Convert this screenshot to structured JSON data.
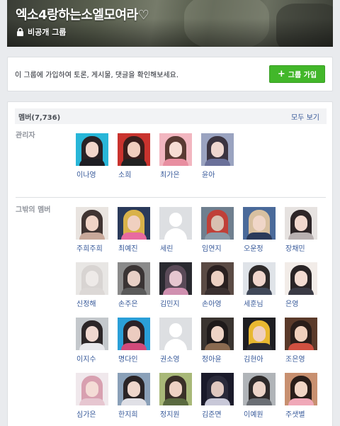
{
  "group": {
    "title": "엑소4랑하는소엘모여라♡",
    "privacy": "비공개 그룹",
    "join_prompt": "이 그룹에 가입하여 토론, 게시물, 댓글을 확인해보세요.",
    "join_button": "그룹 가입"
  },
  "members": {
    "header": "멤버(7,736)",
    "see_all": "모두 보기",
    "admins_label": "관리자",
    "others_label": "그밖의 멤버",
    "admins": [
      {
        "name": "이나영",
        "bg": "#28b6d8",
        "hair": "#2a2226",
        "skin": "#f2d6cc",
        "body": "#1e1e24"
      },
      {
        "name": "소희",
        "bg": "#c9332e",
        "hair": "#3a1e1c",
        "skin": "#f0cdbd",
        "body": "#222222"
      },
      {
        "name": "최가은",
        "bg": "#f2b6c0",
        "hair": "#5a3a33",
        "skin": "#f6ddd4",
        "body": "#e88ea0"
      },
      {
        "name": "윤아",
        "bg": "#9aa3c0",
        "hair": "#3b3440",
        "skin": "#efd7cf",
        "body": "#6a7099"
      }
    ],
    "others": [
      {
        "name": "주희주희",
        "bg": "#e9e4e0",
        "hair": "#403432",
        "skin": "#f0d3c6",
        "body": "#c8a89a"
      },
      {
        "name": "최예진",
        "bg": "#2a3a5a",
        "hair": "#d9b24a",
        "skin": "#f0d0c0",
        "body": "#e86aa0"
      },
      {
        "name": "세린",
        "default": true
      },
      {
        "name": "임연지",
        "bg": "#6f7f8f",
        "hair": "#c04038",
        "skin": "#d8c0b0",
        "body": "#8a9aa8"
      },
      {
        "name": "오운정",
        "bg": "#4a6a9a",
        "hair": "#d8c0a0",
        "skin": "#f0d6c8",
        "body": "#2a3a5a"
      },
      {
        "name": "장채민",
        "bg": "#e6e2e0",
        "hair": "#2e2628",
        "skin": "#f2d8ce",
        "body": "#b8b0b0"
      },
      {
        "name": "신정해",
        "bg": "#e8e6e4",
        "hair": "#d8d4d2",
        "skin": "#eeeae8",
        "body": "#dcd8d6"
      },
      {
        "name": "손주은",
        "bg": "#8a8a8a",
        "hair": "#3a3434",
        "skin": "#e8d0c6",
        "body": "#5a5a5a"
      },
      {
        "name": "김민지",
        "bg": "#2a2a30",
        "hair": "#5a4a58",
        "skin": "#e6c6d0",
        "body": "#d090b0"
      },
      {
        "name": "손아영",
        "bg": "#5a4a44",
        "hair": "#2a2020",
        "skin": "#ecd0c2",
        "body": "#3a3030"
      },
      {
        "name": "세훈님",
        "bg": "#dfe3e8",
        "hair": "#2e2a2a",
        "skin": "#f0d6cc",
        "body": "#404858"
      },
      {
        "name": "은영",
        "bg": "#f2ece8",
        "hair": "#2a2426",
        "skin": "#f4dcd2",
        "body": "#3a3a44"
      },
      {
        "name": "이지수",
        "bg": "#c4c8cc",
        "hair": "#2c2628",
        "skin": "#f0d8d0",
        "body": "#e8e8ec"
      },
      {
        "name": "명다인",
        "bg": "#2a9fd8",
        "hair": "#2a2228",
        "skin": "#ecccc0",
        "body": "#d24a7a"
      },
      {
        "name": "권소영",
        "default": true
      },
      {
        "name": "정아윤",
        "bg": "#3a3430",
        "hair": "#1e1a1a",
        "skin": "#eed4c6",
        "body": "#8a6a50"
      },
      {
        "name": "김현아",
        "bg": "#1e1e22",
        "hair": "#e8b830",
        "skin": "#f0d0c0",
        "body": "#2a2a30"
      },
      {
        "name": "조은영",
        "bg": "#5a3a2a",
        "hair": "#2a1e1a",
        "skin": "#f0d0bc",
        "body": "#d05040"
      },
      {
        "name": "심가은",
        "bg": "#f0e8ec",
        "hair": "#d8a0b0",
        "skin": "#f4dcd6",
        "body": "#e6c6d0"
      },
      {
        "name": "한지희",
        "bg": "#8aa0b8",
        "hair": "#2a2426",
        "skin": "#eed6cc",
        "body": "#e0e0e6"
      },
      {
        "name": "정지원",
        "bg": "#a8b878",
        "hair": "#3a3028",
        "skin": "#eed2c4",
        "body": "#5a6a40"
      },
      {
        "name": "김준면",
        "bg": "#1a1a2a",
        "hair": "#2a2a3a",
        "skin": "#e0c8c0",
        "body": "#c8c8d8"
      },
      {
        "name": "이예원",
        "bg": "#b0b4b8",
        "hair": "#2e2a2a",
        "skin": "#ecd4c8",
        "body": "#6a6e74"
      },
      {
        "name": "주샛별",
        "bg": "#c89070",
        "hair": "#2a1e1a",
        "skin": "#f2d6c6",
        "body": "#f0a8b8"
      }
    ]
  }
}
